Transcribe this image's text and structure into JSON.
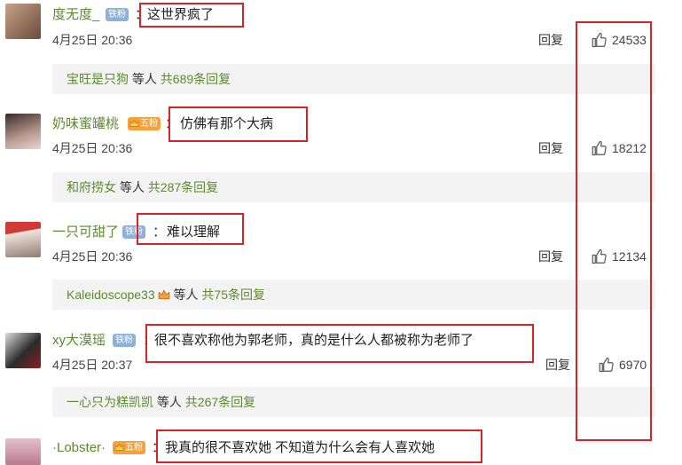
{
  "comments": [
    {
      "username": "度无度_",
      "badge": "铁粉",
      "badge_type": "iron",
      "text": "这世界疯了",
      "time": "4月25日 20:36",
      "reply": "回复",
      "likes": "24533",
      "sub": {
        "name": "宝旺是只狗",
        "mid": " 等人 ",
        "count": "共689条回复"
      }
    },
    {
      "username": "奶味蜜罐桃",
      "badge": "五粉",
      "badge_type": "fan",
      "text": "仿佛有那个大病",
      "time": "4月25日 20:36",
      "reply": "回复",
      "likes": "18212",
      "sub": {
        "name": "和府捞女",
        "mid": " 等人 ",
        "count": "共287条回复"
      }
    },
    {
      "username": "一只可甜了",
      "badge": "铁粉",
      "badge_type": "iron",
      "text": "难以理解",
      "time": "4月25日 20:36",
      "reply": "回复",
      "likes": "12134",
      "sub": {
        "name": "Kaleidoscope33",
        "mid": " 等人 ",
        "count": "共75条回复"
      }
    },
    {
      "username": "xy大漠瑶",
      "badge": "铁粉",
      "badge_type": "iron",
      "text": "很不喜欢称他为郭老师，真的是什么人都被称为老师了",
      "time": "4月25日 20:37",
      "reply": "回复",
      "likes": "6970",
      "sub": {
        "name": "一心只为糕凯凯",
        "mid": " 等人 ",
        "count": "共267条回复"
      }
    },
    {
      "username": "·Lobster·",
      "badge": "五粉",
      "badge_type": "fan",
      "text": "我真的很不喜欢她 不知道为什么会有人喜欢她"
    }
  ],
  "colon": "：",
  "icons": {
    "like": "thumbs-up-icon",
    "crown": "crown-icon"
  },
  "colors": {
    "highlight": "#d8232a",
    "username": "#5c8a2e",
    "iron_badge": "#8fb1d8",
    "fan_badge": "#f3a23c"
  }
}
